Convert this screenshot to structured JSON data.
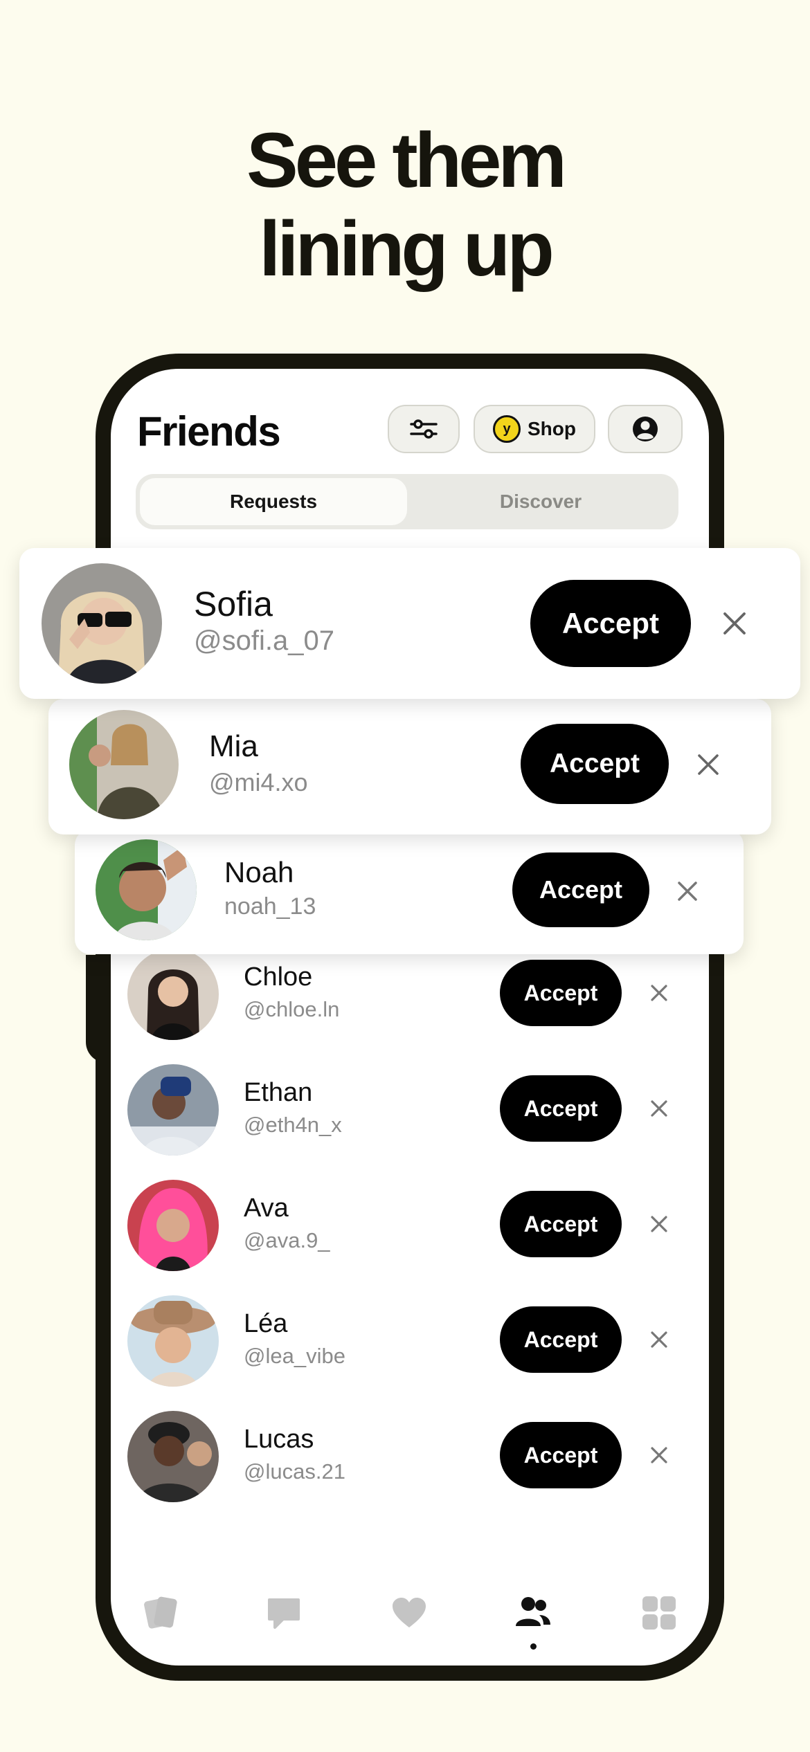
{
  "headline": {
    "line1": "See them",
    "line2": "lining up"
  },
  "screen": {
    "title": "Friends",
    "shop_label": "Shop",
    "coin_glyph": "y",
    "tabs": [
      {
        "label": "Requests",
        "active": true
      },
      {
        "label": "Discover",
        "active": false
      }
    ]
  },
  "requests": [
    {
      "name": "Sofia",
      "handle": "@sofi.a_07",
      "accept": "Accept",
      "avatar_color": "#8d8b8a"
    },
    {
      "name": "Mia",
      "handle": "@mi4.xo",
      "accept": "Accept",
      "avatar_color": "#7b6c55"
    },
    {
      "name": "Noah",
      "handle": "noah_13",
      "accept": "Accept",
      "avatar_color": "#a87b62"
    },
    {
      "name": "Chloe",
      "handle": "@chloe.ln",
      "accept": "Accept",
      "avatar_color": "#3a2d28"
    },
    {
      "name": "Ethan",
      "handle": "@eth4n_x",
      "accept": "Accept",
      "avatar_color": "#5b6b7e"
    },
    {
      "name": "Ava",
      "handle": "@ava.9_",
      "accept": "Accept",
      "avatar_color": "#e84b8d"
    },
    {
      "name": "Léa",
      "handle": "@lea_vibe",
      "accept": "Accept",
      "avatar_color": "#b98f70"
    },
    {
      "name": "Lucas",
      "handle": "@lucas.21",
      "accept": "Accept",
      "avatar_color": "#4a4240"
    }
  ],
  "tabbar": {
    "items": [
      {
        "icon": "cards-icon",
        "active": false
      },
      {
        "icon": "chat-icon",
        "active": false
      },
      {
        "icon": "heart-icon",
        "active": false
      },
      {
        "icon": "friends-icon",
        "active": true
      },
      {
        "icon": "grid-icon",
        "active": false
      }
    ]
  },
  "colors": {
    "background": "#fdfcee",
    "phone": "#17160d",
    "accept": "#000000",
    "coin": "#f2d41b"
  }
}
